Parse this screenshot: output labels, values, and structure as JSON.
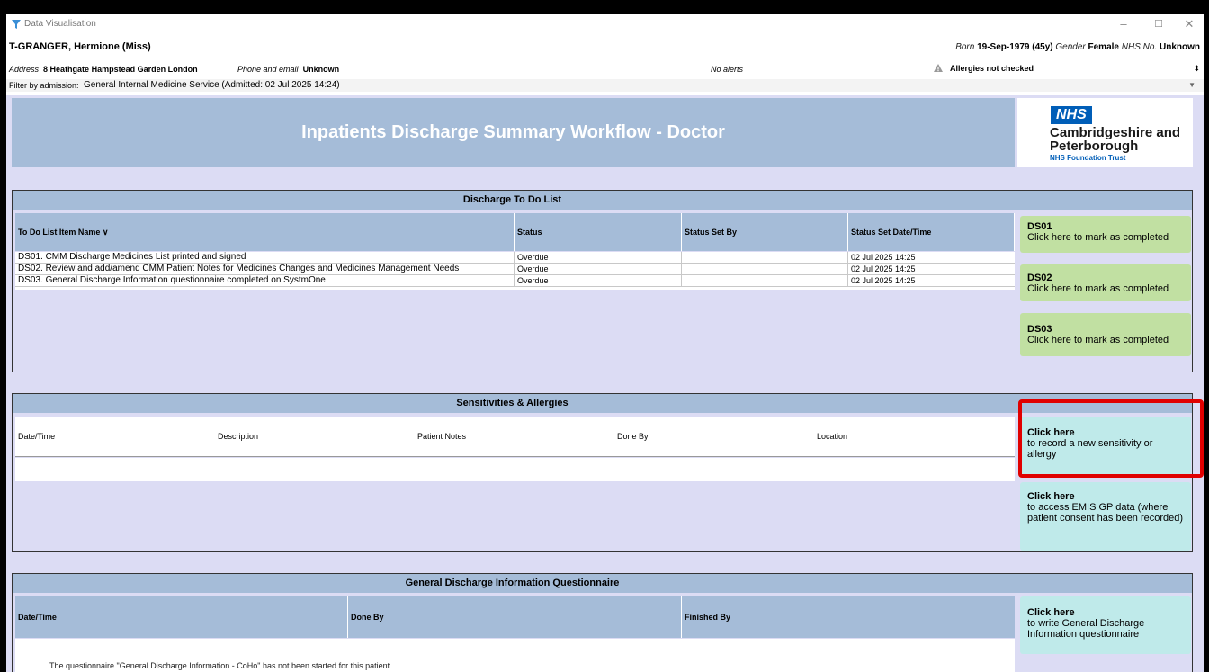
{
  "window": {
    "title": "Data Visualisation",
    "minimize": "–",
    "maximize": "☐",
    "close": "✕"
  },
  "patient": {
    "name": "T-GRANGER, Hermione (Miss)",
    "born_label": "Born",
    "born_value": "19-Sep-1979 (45y)",
    "gender_label": "Gender",
    "gender_value": "Female",
    "nhs_label": "NHS No.",
    "nhs_value": "Unknown",
    "address_label": "Address",
    "address_value": "8 Heathgate Hampstead Garden London",
    "phone_label": "Phone and email",
    "phone_value": "Unknown",
    "alerts": "No alerts",
    "allergies": "Allergies not checked",
    "expand_glyph": "⬍"
  },
  "filter": {
    "label": "Filter by admission:",
    "value": "General Internal Medicine Service (Admitted: 02 Jul 2025 14:24)"
  },
  "header": {
    "title": "Inpatients Discharge Summary Workflow  -  Doctor",
    "logo_nhs": "NHS",
    "logo_trust_line1": "Cambridgeshire and",
    "logo_trust_line2": "Peterborough",
    "logo_trust_sub": "NHS Foundation Trust"
  },
  "todo": {
    "title": "Discharge To Do List",
    "columns": [
      "To Do List Item Name ∨",
      "Status",
      "Status Set By",
      "Status Set Date/Time"
    ],
    "rows": [
      {
        "name": "DS01. CMM Discharge Medicines List printed and signed",
        "status": "Overdue",
        "set_by": "",
        "datetime": "02 Jul 2025 14:25"
      },
      {
        "name": "DS02. Review and add/amend CMM Patient Notes for Medicines Changes and Medicines Management Needs",
        "status": "Overdue",
        "set_by": "",
        "datetime": "02 Jul 2025 14:25"
      },
      {
        "name": "DS03. General Discharge Information questionnaire completed on SystmOne",
        "status": "Overdue",
        "set_by": "",
        "datetime": "02 Jul 2025 14:25"
      }
    ],
    "buttons": [
      {
        "code": "DS01",
        "text": "Click here to mark as completed"
      },
      {
        "code": "DS02",
        "text": "Click here to mark as completed"
      },
      {
        "code": "DS03",
        "text": "Click here to mark as completed"
      }
    ]
  },
  "allergies": {
    "title": "Sensitivities & Allergies",
    "columns": [
      "Date/Time",
      "Description",
      "Patient Notes",
      "Done By",
      "Location"
    ],
    "record_button": {
      "title": "Click here",
      "text": "to record a new sensitivity or allergy"
    },
    "emis_button": {
      "title": "Click here",
      "text": "to access EMIS GP data (where patient consent has been recorded)"
    }
  },
  "questionnaire": {
    "title": "General Discharge Information Questionnaire",
    "columns": [
      "Date/Time",
      "Done By",
      "Finished By"
    ],
    "button": {
      "title": "Click here",
      "text": "to write General Discharge Information questionnaire"
    },
    "note": "The questionnaire \"General Discharge Information - CoHo\" has not been started for this patient."
  },
  "colors": {
    "header_band": "#a5bcd8",
    "background": "#dcdcf4",
    "green_button": "#c1e0a2",
    "cyan_button": "#bfeaea",
    "highlight": "#e00000",
    "nhs_blue": "#005eb8"
  }
}
